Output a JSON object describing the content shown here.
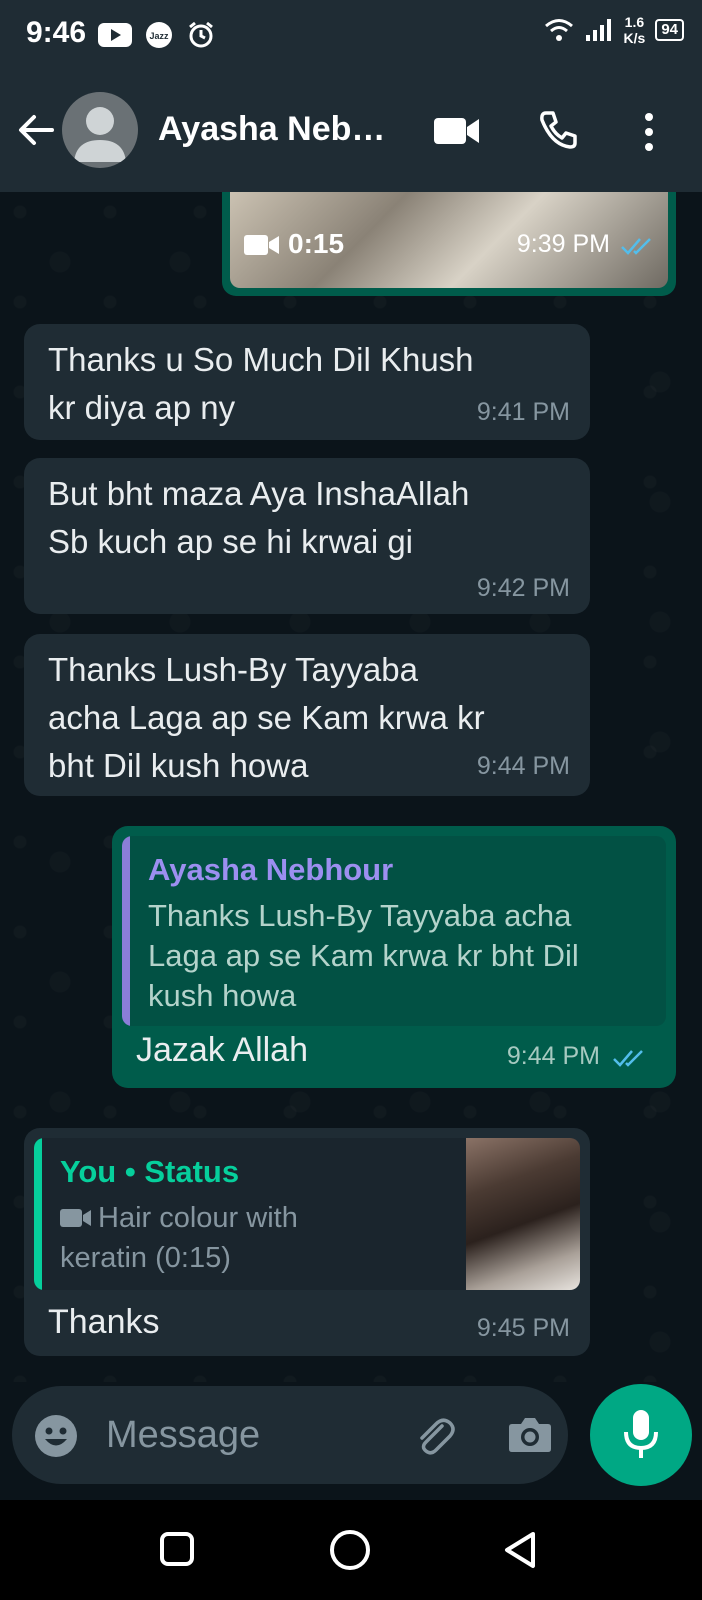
{
  "status_bar": {
    "time": "9:46",
    "speed_value": "1.6",
    "speed_unit": "K/s",
    "battery": "94",
    "carrier": "Jazz"
  },
  "header": {
    "contact_name": "Ayasha Neb…"
  },
  "messages": [
    {
      "type": "video",
      "direction": "outgoing",
      "duration": "0:15",
      "time": "9:39 PM",
      "read": true
    },
    {
      "type": "text",
      "direction": "incoming",
      "lines": [
        "Thanks u So Much Dil Khush",
        "kr diya ap ny"
      ],
      "time": "9:41 PM"
    },
    {
      "type": "text",
      "direction": "incoming",
      "lines": [
        "But bht maza Aya InshaAllah",
        "Sb kuch ap se hi krwai gi"
      ],
      "time": "9:42 PM"
    },
    {
      "type": "text",
      "direction": "incoming",
      "lines": [
        "Thanks Lush-By Tayyaba",
        "acha Laga ap se Kam krwa kr",
        "bht Dil kush howa"
      ],
      "time": "9:44 PM"
    },
    {
      "type": "reply",
      "direction": "outgoing",
      "quote_name": "Ayasha Nebhour",
      "quote_lines": [
        "Thanks Lush-By Tayyaba acha",
        "Laga ap se Kam krwa kr bht Dil",
        "kush howa"
      ],
      "text": "Jazak Allah",
      "time": "9:44 PM",
      "read": true
    },
    {
      "type": "status-reply",
      "direction": "incoming",
      "status_title": "You • Status",
      "status_lines": [
        "Hair colour with",
        "keratin (0:15)"
      ],
      "text": "Thanks",
      "time": "9:45 PM"
    }
  ],
  "input": {
    "placeholder": "Message"
  },
  "colors": {
    "outgoing_bubble": "#005c4b",
    "incoming_bubble": "#1f2c34",
    "accent": "#00a884",
    "read_ticks": "#53bdeb"
  }
}
